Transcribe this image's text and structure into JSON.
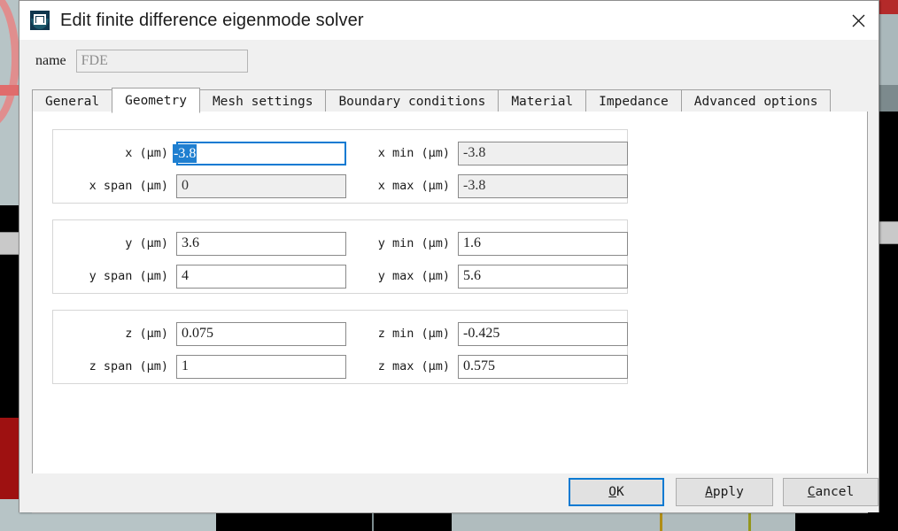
{
  "window": {
    "title": "Edit finite difference eigenmode solver",
    "icon": "lumerical-fde-icon",
    "close_label": "close-icon"
  },
  "name_field": {
    "label": "name",
    "value": "FDE",
    "disabled": true
  },
  "tabs": [
    {
      "label": "General",
      "active": false
    },
    {
      "label": "Geometry",
      "active": true
    },
    {
      "label": "Mesh settings",
      "active": false
    },
    {
      "label": "Boundary conditions",
      "active": false
    },
    {
      "label": "Material",
      "active": false
    },
    {
      "label": "Impedance",
      "active": false
    },
    {
      "label": "Advanced options",
      "active": false
    }
  ],
  "groups": [
    {
      "id": "x",
      "fields": [
        {
          "label": "x (μm)",
          "value": "-3.8",
          "disabled": false,
          "focused": true,
          "selected": true
        },
        {
          "label": "x min (μm)",
          "value": "-3.8",
          "disabled": true,
          "focused": false,
          "selected": false
        },
        {
          "label": "x span (μm)",
          "value": "0",
          "disabled": true,
          "focused": false,
          "selected": false
        },
        {
          "label": "x max (μm)",
          "value": "-3.8",
          "disabled": true,
          "focused": false,
          "selected": false
        }
      ]
    },
    {
      "id": "y",
      "fields": [
        {
          "label": "y (μm)",
          "value": "3.6",
          "disabled": false,
          "focused": false,
          "selected": false
        },
        {
          "label": "y min (μm)",
          "value": "1.6",
          "disabled": false,
          "focused": false,
          "selected": false
        },
        {
          "label": "y span (μm)",
          "value": "4",
          "disabled": false,
          "focused": false,
          "selected": false
        },
        {
          "label": "y max (μm)",
          "value": "5.6",
          "disabled": false,
          "focused": false,
          "selected": false
        }
      ]
    },
    {
      "id": "z",
      "fields": [
        {
          "label": "z (μm)",
          "value": "0.075",
          "disabled": false,
          "focused": false,
          "selected": false
        },
        {
          "label": "z min (μm)",
          "value": "-0.425",
          "disabled": false,
          "focused": false,
          "selected": false
        },
        {
          "label": "z span (μm)",
          "value": "1",
          "disabled": false,
          "focused": false,
          "selected": false
        },
        {
          "label": "z max (μm)",
          "value": "0.575",
          "disabled": false,
          "focused": false,
          "selected": false
        }
      ]
    }
  ],
  "footer": {
    "ok": {
      "prefix": "",
      "mnemonic": "O",
      "suffix": "K",
      "primary": true
    },
    "apply": {
      "prefix": "",
      "mnemonic": "A",
      "suffix": "pply",
      "primary": false
    },
    "cancel": {
      "prefix": "",
      "mnemonic": "C",
      "suffix": "ancel",
      "primary": false
    }
  },
  "colors": {
    "accent": "#0a7ad2",
    "selection": "#1f7fd0",
    "dialog_bg": "#f0f0f0",
    "panel_bg": "#ffffff",
    "button_bg": "#e1e1e1",
    "border": "#a0a0a0"
  }
}
